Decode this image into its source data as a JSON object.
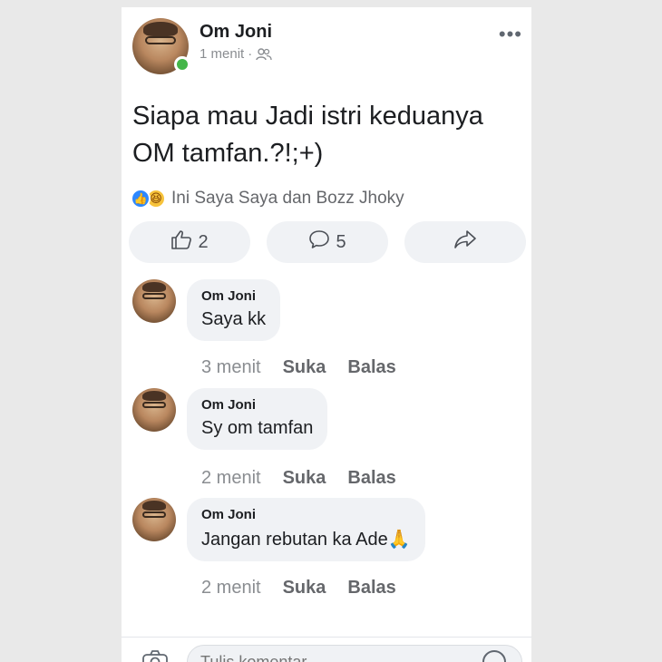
{
  "post": {
    "author": "Om Joni",
    "time": "1 menit",
    "separator": "·",
    "audience_icon": "friends-icon",
    "more_icon": "•••",
    "text_line1": "Siapa mau Jadi istri keduanya",
    "text_line2": "OM tamfan.?!;+)",
    "reactions_text": "Ini Saya Saya dan Bozz Jhoky",
    "like_count": "2",
    "comment_count": "5"
  },
  "comments": [
    {
      "name": "Om Joni",
      "text": "Saya kk",
      "time": "3 menit",
      "like": "Suka",
      "reply": "Balas"
    },
    {
      "name": "Om Joni",
      "text": "Sy om tamfan",
      "time": "2 menit",
      "like": "Suka",
      "reply": "Balas"
    },
    {
      "name": "Om Joni",
      "text": "Jangan rebutan ka Ade🙏",
      "time": "2 menit",
      "like": "Suka",
      "reply": "Balas"
    }
  ],
  "composer": {
    "placeholder": "Tulis komentar..."
  },
  "colors": {
    "like_blue": "#2d88ff",
    "online_green": "#44b649",
    "pill_bg": "#f0f2f5"
  }
}
